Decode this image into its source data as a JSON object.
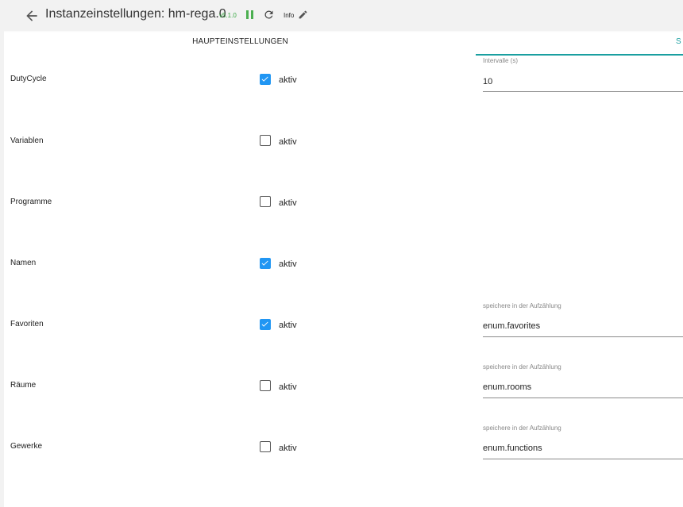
{
  "header": {
    "title": "Instanzeinstellungen: hm-rega.0",
    "version": "v5.1.0",
    "info_label": "Info"
  },
  "tabs": [
    {
      "label": "HAUPTEINSTELLUNGEN"
    },
    {
      "label": "S"
    }
  ],
  "rows": [
    {
      "label": "DutyCycle",
      "checkbox_label": "aktiv",
      "checked": true
    },
    {
      "label": "Variablen",
      "checkbox_label": "aktiv",
      "checked": false
    },
    {
      "label": "Programme",
      "checkbox_label": "aktiv",
      "checked": false
    },
    {
      "label": "Namen",
      "checkbox_label": "aktiv",
      "checked": true
    },
    {
      "label": "Favoriten",
      "checkbox_label": "aktiv",
      "checked": true
    },
    {
      "label": "Räume",
      "checkbox_label": "aktiv",
      "checked": false
    },
    {
      "label": "Gewerke",
      "checkbox_label": "aktiv",
      "checked": false
    }
  ],
  "fields": {
    "interval": {
      "caption": "Intervalle (s)",
      "value": "10"
    },
    "favorites": {
      "caption": "speichere in der Aufzählung",
      "value": "enum.favorites"
    },
    "rooms": {
      "caption": "speichere in der Aufzählung",
      "value": "enum.rooms"
    },
    "functions": {
      "caption": "speichere in der Aufzählung",
      "value": "enum.functions"
    }
  },
  "colors": {
    "accent_teal": "#1a9fa0",
    "checkbox_blue": "#2196f3",
    "running_green": "#4caf50"
  },
  "icons": [
    "arrow-left-icon",
    "pause-icon",
    "reload-icon",
    "pencil-icon"
  ]
}
